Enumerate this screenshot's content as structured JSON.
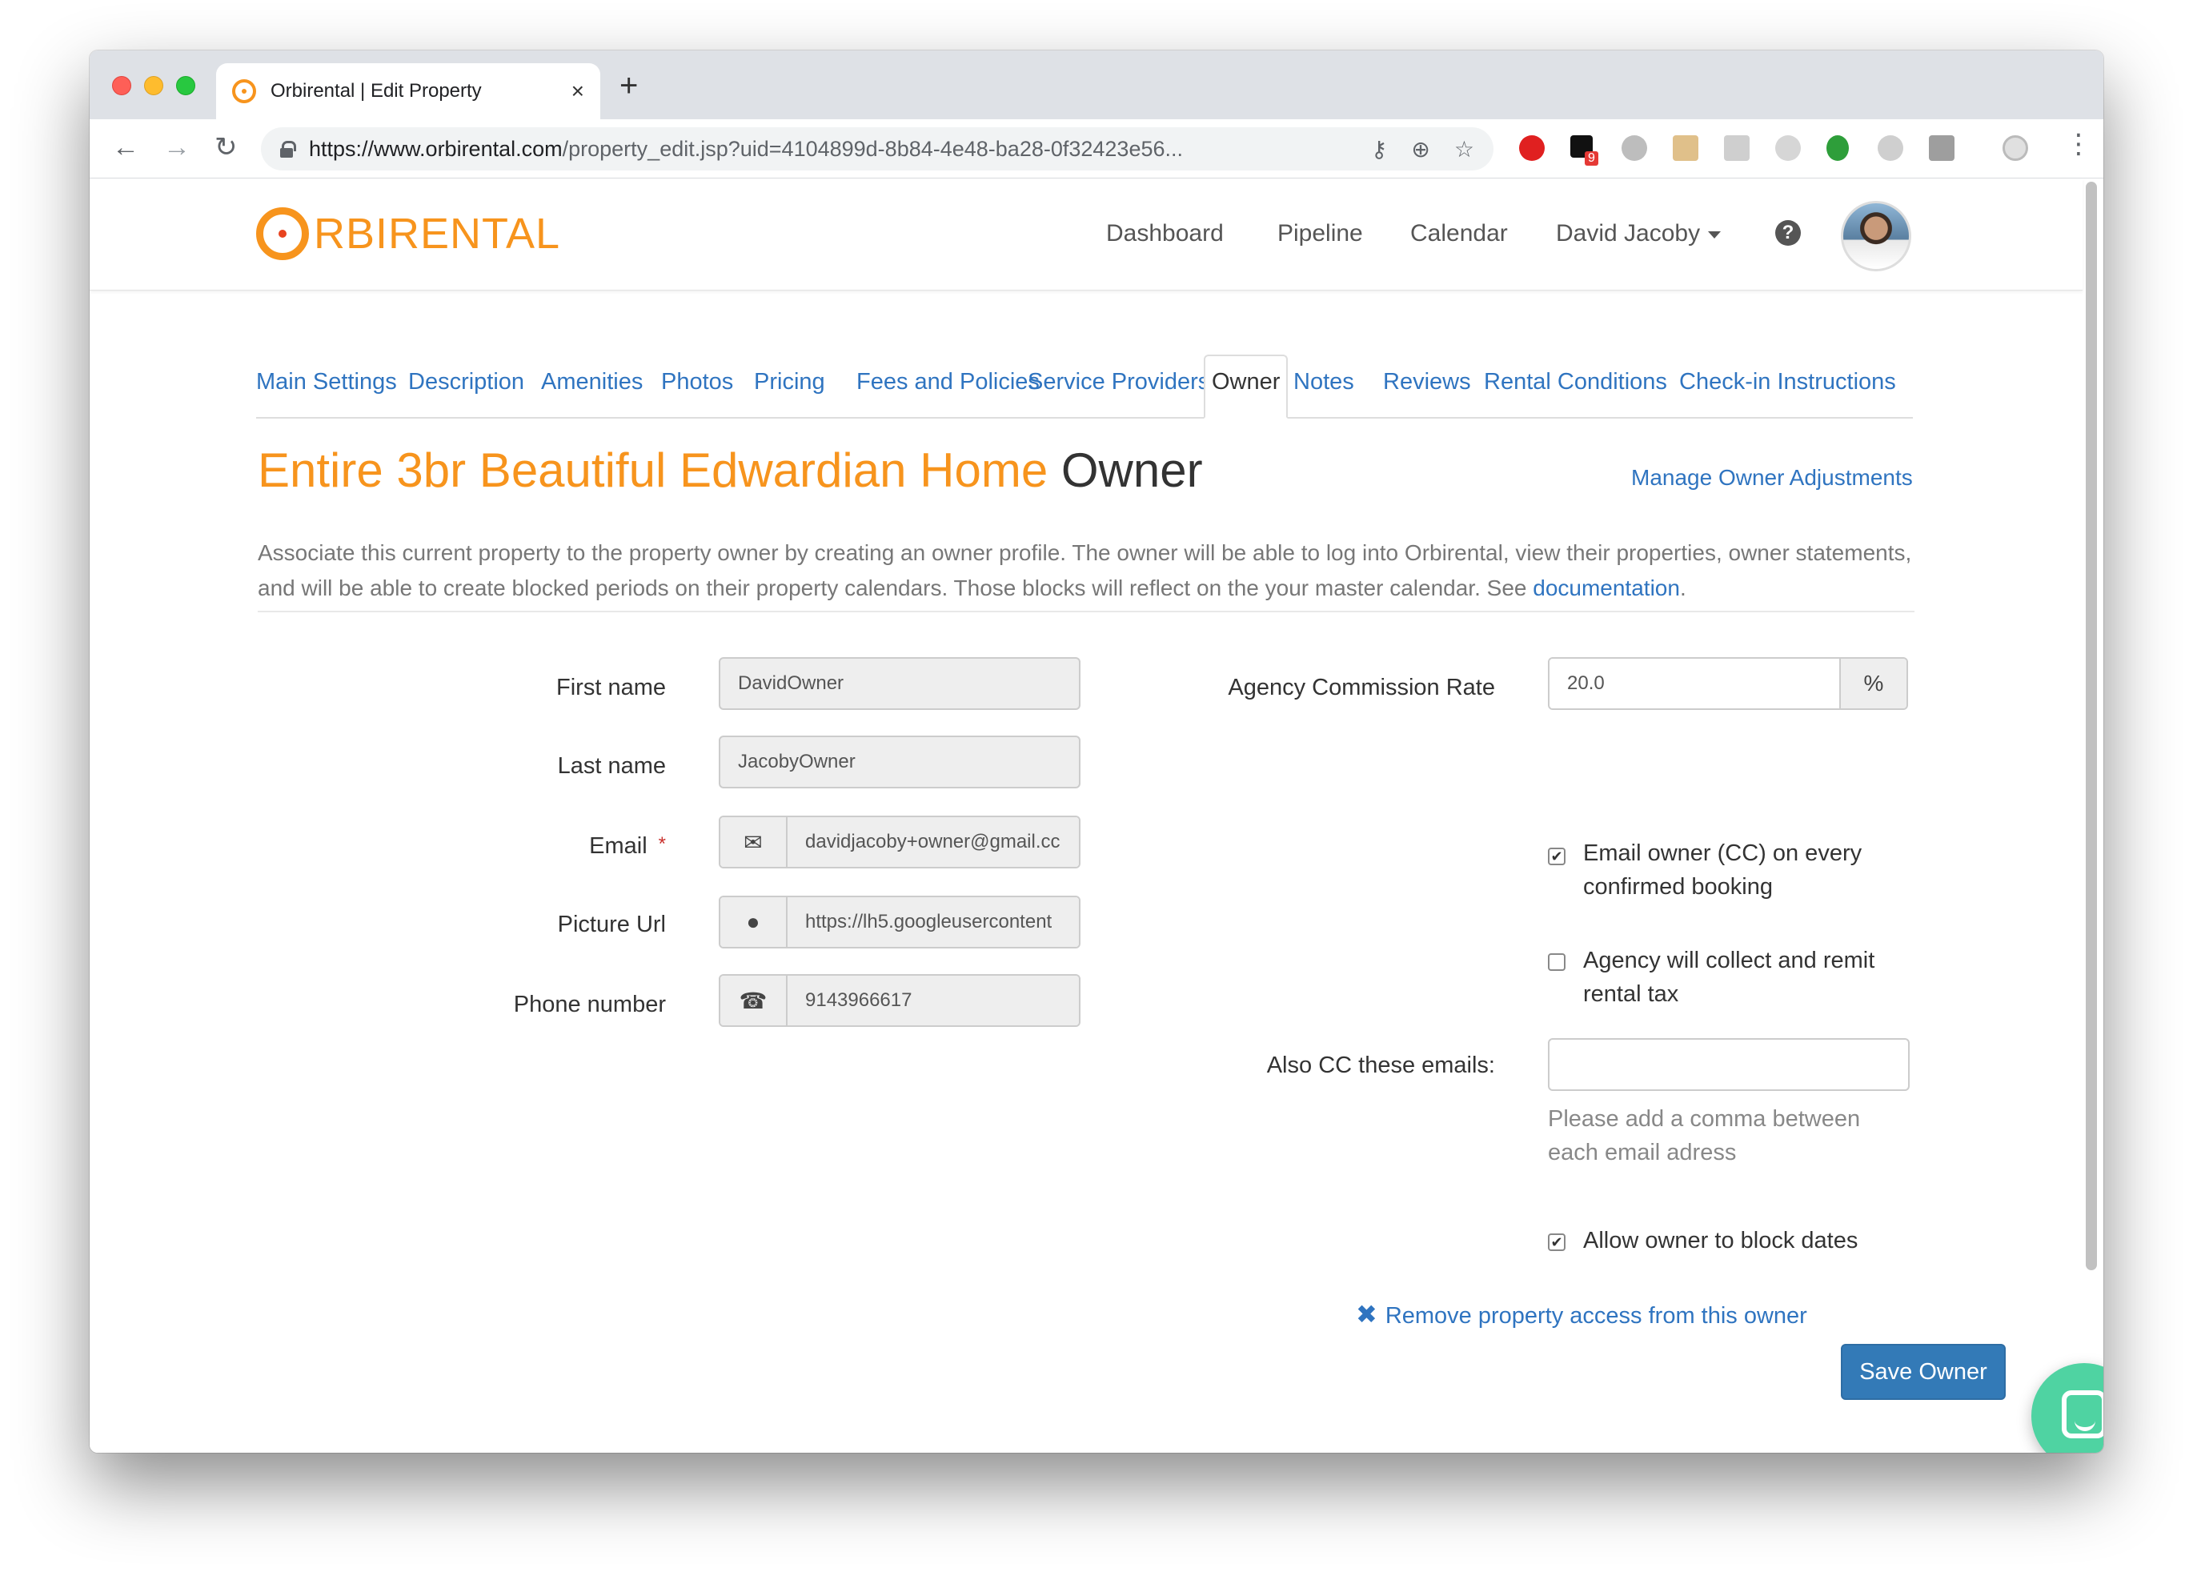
{
  "browser": {
    "tab_title": "Orbirental | Edit Property",
    "tab_close": "×",
    "new_tab": "+",
    "url_host": "https://www.orbirental.com",
    "url_path": "/property_edit.jsp?uid=4104899d-8b84-4e48-ba28-0f32423e56...",
    "extension_badge": "9",
    "icons": [
      "back-icon",
      "forward-icon",
      "reload-icon",
      "lock-icon",
      "key-icon",
      "zoom-icon",
      "star-icon",
      "menu-dots-icon"
    ]
  },
  "navbar": {
    "logo_text": "RBIRENTAL",
    "links": [
      "Dashboard",
      "Pipeline",
      "Calendar"
    ],
    "user": "David Jacoby",
    "help": "?"
  },
  "tabs": [
    "Main Settings",
    "Description",
    "Amenities",
    "Photos",
    "Pricing",
    "Fees and Policies",
    "Service Providers",
    "Owner",
    "Notes",
    "Reviews",
    "Rental Conditions",
    "Check-in Instructions"
  ],
  "active_tab": "Owner",
  "header": {
    "property_name": "Entire 3br Beautiful Edwardian Home",
    "section": "Owner",
    "manage_link": "Manage Owner Adjustments"
  },
  "description": {
    "text": "Associate this current property to the property owner by creating an owner profile. The owner will be able to log into Orbirental, view their properties, owner statements, and will be able to create blocked periods on their property calendars. Those blocks will reflect on the your master calendar. See ",
    "link": "documentation",
    "end": "."
  },
  "form": {
    "first_name": {
      "label": "First name",
      "value": "DavidOwner"
    },
    "last_name": {
      "label": "Last name",
      "value": "JacobyOwner"
    },
    "email": {
      "label": "Email",
      "required": "*",
      "value": "davidjacoby+owner@gmail.cc"
    },
    "picture_url": {
      "label": "Picture Url",
      "value": "https://lh5.googleusercontent"
    },
    "phone": {
      "label": "Phone number",
      "value": "9143966617"
    },
    "commission": {
      "label": "Agency Commission Rate",
      "value": "20.0",
      "unit": "%"
    },
    "cc_booking": {
      "label": "Email owner (CC) on every confirmed booking",
      "checked": true
    },
    "collect_tax": {
      "label": "Agency will collect and remit rental tax",
      "checked": false
    },
    "also_cc": {
      "label": "Also CC these emails:",
      "value": "",
      "hint": "Please add a comma between each email adress"
    },
    "allow_block": {
      "label": "Allow owner to block dates",
      "checked": true
    }
  },
  "actions": {
    "remove": "Remove property access from this owner",
    "remove_icon": "✖",
    "save": "Save Owner"
  },
  "colors": {
    "brand_orange": "#f7941d",
    "link_blue": "#2f74c0",
    "primary_button": "#337ab7",
    "chat_green": "#4fd3a2"
  }
}
